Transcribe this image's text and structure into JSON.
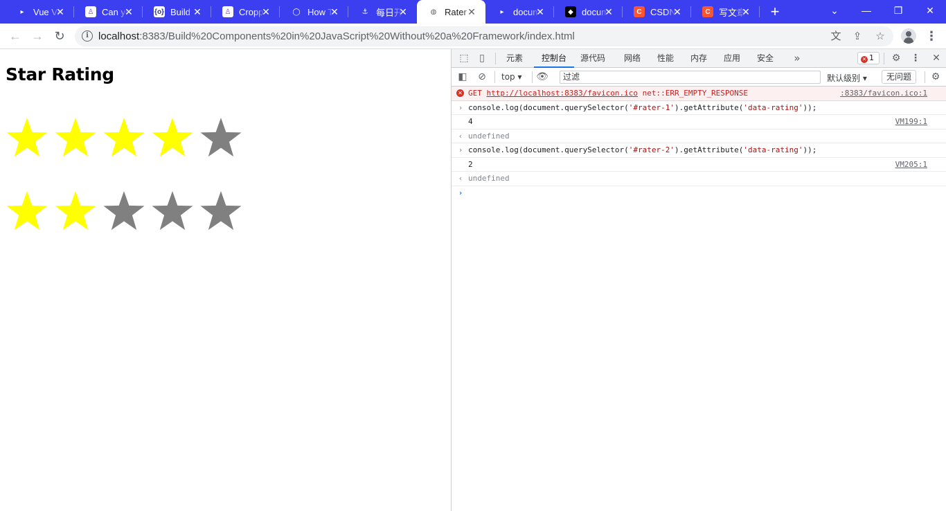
{
  "tabs": [
    {
      "title": "Vue Vi",
      "favicon_text": "",
      "favicon_color": "#4b4ff2",
      "active": false
    },
    {
      "title": "Can yo",
      "favicon_text": "♙",
      "favicon_color": "#7b3fe4",
      "active": false
    },
    {
      "title": "Build ",
      "favicon_text": "{o}",
      "favicon_color": "#2b2f7a",
      "active": false
    },
    {
      "title": "Cropp",
      "favicon_text": "♙",
      "favicon_color": "#7b3fe4",
      "active": false
    },
    {
      "title": "How T",
      "favicon_text": "◯",
      "favicon_color": "#4f46e5",
      "active": false
    },
    {
      "title": "每日开",
      "favicon_text": "⚓",
      "favicon_color": "#3b3ff0",
      "active": false
    },
    {
      "title": "Rater",
      "favicon_text": "◍",
      "favicon_color": "#5f6368",
      "active": true
    },
    {
      "title": "docum",
      "favicon_text": "",
      "favicon_color": "#4b4ff2",
      "active": false
    },
    {
      "title": "docum",
      "favicon_text": "◆",
      "favicon_color": "#000000",
      "active": false
    },
    {
      "title": "CSDN",
      "favicon_text": "C",
      "favicon_color": "#fc5531",
      "active": false
    },
    {
      "title": "写文章",
      "favicon_text": "C",
      "favicon_color": "#fc5531",
      "active": false
    }
  ],
  "address": {
    "host": "localhost",
    "path": ":8383/Build%20Components%20in%20JavaScript%20Without%20a%20Framework/index.html"
  },
  "page": {
    "title": "Star Rating",
    "raters": [
      {
        "id": "rater-1",
        "rating": 4,
        "max": 5
      },
      {
        "id": "rater-2",
        "rating": 2,
        "max": 5
      }
    ],
    "colors": {
      "filled": "#ffff00",
      "empty": "#808080"
    }
  },
  "devtools": {
    "tabs": [
      "元素",
      "控制台",
      "源代码",
      "网络",
      "性能",
      "内存",
      "应用",
      "安全"
    ],
    "active_tab": "控制台",
    "error_count": "1",
    "context": "top",
    "filter_placeholder": "过滤",
    "levels": "默认级别",
    "issues": "无问题",
    "console": {
      "error": {
        "method": "GET",
        "url": "http://localhost:8383/favicon.ico",
        "message": "net::ERR_EMPTY_RESPONSE",
        "source": ":8383/favicon.ico:1"
      },
      "cmd1": {
        "pre": "console.log(document.querySelector(",
        "arg1": "'#rater-1'",
        "mid": ").getAttribute(",
        "arg2": "'data-rating'",
        "post": "));"
      },
      "out1": {
        "value": "4",
        "source": "VM199:1"
      },
      "ret1": "undefined",
      "cmd2": {
        "pre": "console.log(document.querySelector(",
        "arg1": "'#rater-2'",
        "mid": ").getAttribute(",
        "arg2": "'data-rating'",
        "post": "));"
      },
      "out2": {
        "value": "2",
        "source": "VM205:1"
      },
      "ret2": "undefined"
    }
  }
}
